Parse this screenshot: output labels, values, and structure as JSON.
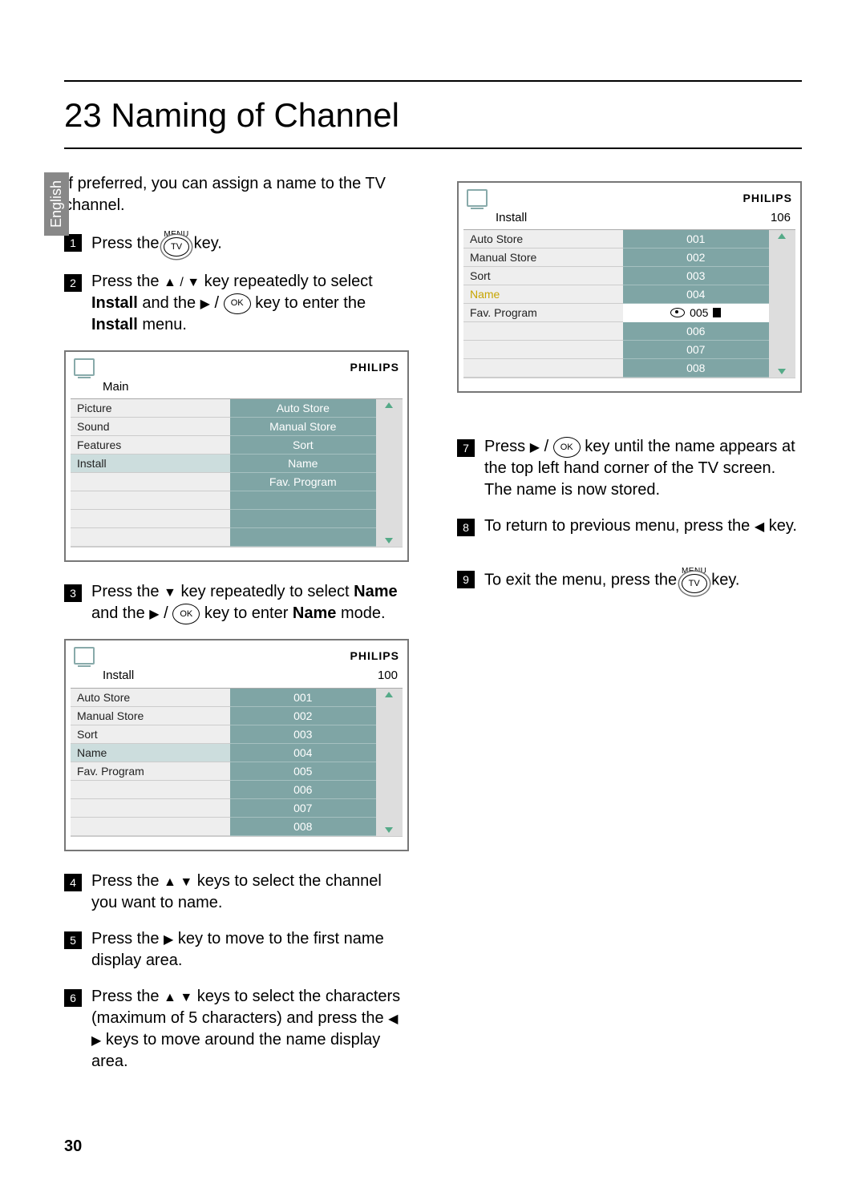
{
  "language_tab": "English",
  "heading": "23   Naming of Channel",
  "intro": "If preferred, you can assign a name to the TV channel.",
  "menu_label": "MENU",
  "steps_left": {
    "s1_a": "Press the ",
    "s1_b": " key.",
    "s2_a": "Press the ",
    "arrows_ud": "▲ / ▼",
    "s2_b": " key repeatedly to select ",
    "s2_bold": "Install",
    "s2_c": " and the ",
    "arrow_r": "▶",
    "s2_d": " / ",
    "s2_e": " key to enter the ",
    "s2_bold2": "Install",
    "s2_f": " menu.",
    "s3_a": "Press the ",
    "arrow_d": "▼",
    "s3_b": " key repeatedly to select ",
    "s3_bold": "Name",
    "s3_c": " and the ",
    "s3_d": " / ",
    "s3_e": " key to enter ",
    "s3_bold2": "Name",
    "s3_f": " mode.",
    "s4_a": "Press the ",
    "arrows_ud2": "▲  ▼",
    "s4_b": " keys to select the channel you want to name.",
    "s5_a": "Press the ",
    "s5_b": " key to move to the first name display area.",
    "s6_a": "Press the ",
    "s6_b": " keys to select the characters (maximum of 5 characters) and press the ",
    "arrows_lr": "◀  ▶",
    "s6_c": " keys to move around the name display area."
  },
  "steps_right": {
    "s7_a": "Press  ",
    "s7_b": " / ",
    "s7_c": " key until the name appears at the top left hand corner of the TV screen. The name is now stored.",
    "s8_a": "To return to previous menu, press the ",
    "arrow_l": "◀",
    "s8_b": " key.",
    "s9_a": "To exit the menu, press the ",
    "s9_b": " key."
  },
  "key_tv": "TV",
  "key_ok": "OK",
  "osd1": {
    "brand": "PHILIPS",
    "title": "Main",
    "left": [
      "Picture",
      "Sound",
      "Features",
      "Install",
      "",
      "",
      "",
      ""
    ],
    "right": [
      "Auto Store",
      "Manual Store",
      "Sort",
      "Name",
      "Fav. Program",
      "",
      "",
      ""
    ]
  },
  "osd2": {
    "brand": "PHILIPS",
    "title": "Install",
    "title_right": "100",
    "left": [
      "Auto Store",
      "Manual Store",
      "Sort",
      "Name",
      "Fav. Program",
      "",
      "",
      ""
    ],
    "right": [
      "001",
      "002",
      "003",
      "004",
      "005",
      "006",
      "007",
      "008"
    ]
  },
  "osd3": {
    "brand": "PHILIPS",
    "title": "Install",
    "title_right": "106",
    "left": [
      "Auto Store",
      "Manual Store",
      "Sort",
      "Name",
      "Fav. Program",
      "",
      "",
      ""
    ],
    "right": [
      "001",
      "002",
      "003",
      "004",
      "005",
      "006",
      "007",
      "008"
    ],
    "entry_text": "005"
  },
  "page_number": "30"
}
